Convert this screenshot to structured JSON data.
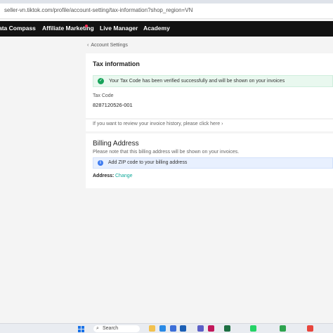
{
  "browser": {
    "url": "seller-vn.tiktok.com/profile/account-setting/tax-information?shop_region=VN"
  },
  "nav": {
    "items": [
      {
        "label": "ata Compass"
      },
      {
        "label": "Affiliate Marketing"
      },
      {
        "label": "Live Manager"
      },
      {
        "label": "Academy"
      }
    ]
  },
  "breadcrumb": {
    "chevron": "‹",
    "label": "Account Settings"
  },
  "tax": {
    "title": "Tax information",
    "success_icon": "✓",
    "success_message": "Your Tax Code has been verified successfully and will be shown on your invoices",
    "code_label": "Tax Code",
    "code_value": "8287120526-001"
  },
  "history": {
    "link_text": "If you want to review your invoice history, please click here ›"
  },
  "billing": {
    "title": "Billing Address",
    "note": "Please note that this billing address will be shown on your invoices.",
    "info_icon": "i",
    "info_message": "Add ZIP code to your billing address",
    "address_label": "Address:",
    "change_link": "Change"
  },
  "taskbar": {
    "search_icon": "⌕",
    "search_placeholder": "Search",
    "apps": [
      "file-explorer-icon",
      "browser-icon",
      "mail-icon",
      "store-icon",
      "teams-icon",
      "excel-icon",
      "whatsapp-icon",
      "chrome-icon",
      "photos-icon",
      "settings-icon"
    ]
  },
  "colors": {
    "nav_bg": "#121212",
    "success_bg": "#e9f8ef",
    "success_icon": "#17a35a",
    "info_bg": "#e8f0fe",
    "info_icon": "#3f7cf0",
    "link": "#11a99a",
    "brand_dot": "#fe2c55"
  }
}
